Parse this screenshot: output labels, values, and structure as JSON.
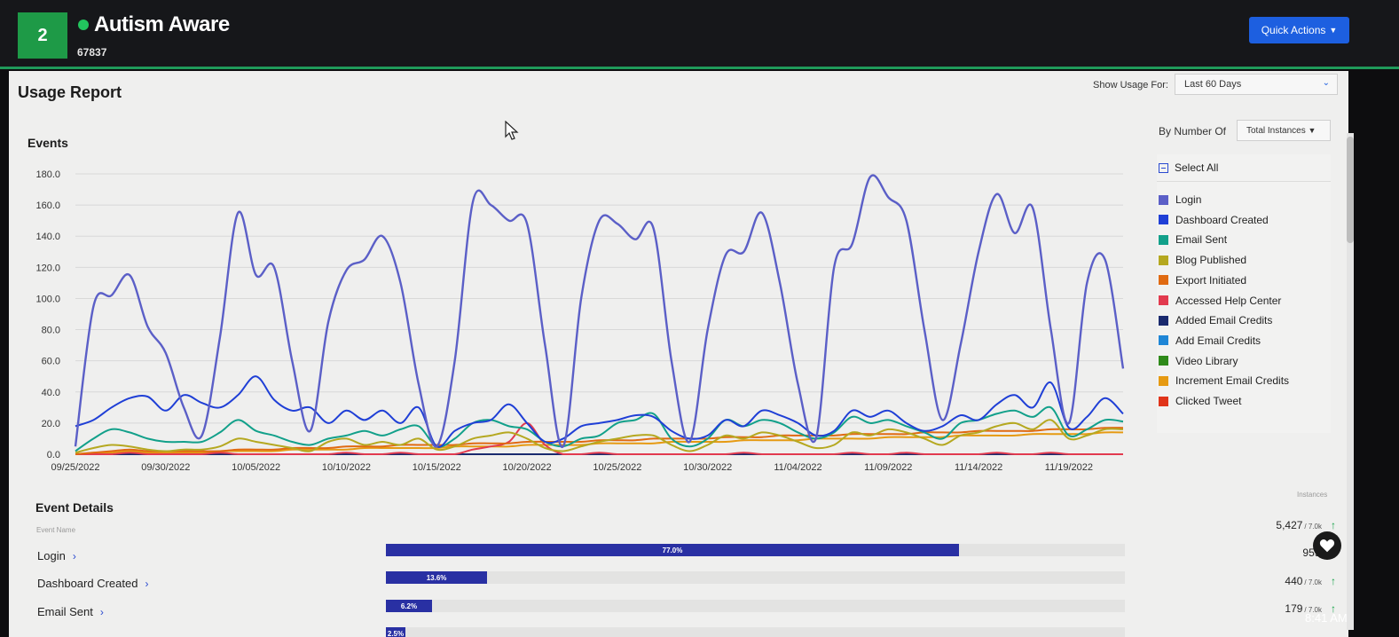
{
  "header": {
    "badge": "2",
    "org_name": "Autism Aware",
    "org_id": "67837",
    "quick_actions_label": "Quick Actions"
  },
  "report": {
    "title": "Usage Report",
    "show_usage_for_label": "Show Usage For:",
    "range_value": "Last 60 Days",
    "by_number_of_label": "By Number Of",
    "metric_value": "Total Instances",
    "events_heading": "Events",
    "select_all_label": "Select All"
  },
  "chart_data": {
    "type": "line",
    "title": "",
    "xlabel": "",
    "ylabel": "",
    "ylim": [
      0,
      180
    ],
    "yticks": [
      "0.0",
      "20.0",
      "40.0",
      "60.0",
      "80.0",
      "100.0",
      "120.0",
      "140.0",
      "160.0",
      "180.0"
    ],
    "x_ticks": [
      "09/25/2022",
      "09/30/2022",
      "10/05/2022",
      "10/10/2022",
      "10/15/2022",
      "10/20/2022",
      "10/25/2022",
      "10/30/2022",
      "11/04/2022",
      "11/09/2022",
      "11/14/2022",
      "11/19/2022"
    ],
    "x_dates": [
      "09/25",
      "09/26",
      "09/27",
      "09/28",
      "09/29",
      "09/30",
      "10/01",
      "10/02",
      "10/03",
      "10/04",
      "10/05",
      "10/06",
      "10/07",
      "10/08",
      "10/09",
      "10/10",
      "10/11",
      "10/12",
      "10/13",
      "10/14",
      "10/15",
      "10/16",
      "10/17",
      "10/18",
      "10/19",
      "10/20",
      "10/21",
      "10/22",
      "10/23",
      "10/24",
      "10/25",
      "10/26",
      "10/27",
      "10/28",
      "10/29",
      "10/30",
      "10/31",
      "11/01",
      "11/02",
      "11/03",
      "11/04",
      "11/05",
      "11/06",
      "11/07",
      "11/08",
      "11/09",
      "11/10",
      "11/11",
      "11/12",
      "11/13",
      "11/14",
      "11/15",
      "11/16",
      "11/17",
      "11/18",
      "11/19",
      "11/20",
      "11/21",
      "11/22"
    ],
    "grid": true,
    "legend_position": "right",
    "series": [
      {
        "name": "Login",
        "color": "#5b5fc7",
        "values": [
          5,
          95,
          102,
          115,
          82,
          65,
          30,
          12,
          75,
          155,
          115,
          120,
          60,
          15,
          85,
          118,
          125,
          140,
          110,
          45,
          5,
          60,
          162,
          160,
          150,
          148,
          70,
          5,
          100,
          150,
          148,
          138,
          145,
          60,
          8,
          80,
          128,
          130,
          155,
          110,
          45,
          10,
          120,
          135,
          178,
          165,
          150,
          80,
          22,
          70,
          130,
          167,
          142,
          158,
          80,
          20,
          110,
          125,
          55
        ]
      },
      {
        "name": "Dashboard Created",
        "color": "#1f3fd6",
        "values": [
          18,
          22,
          30,
          36,
          37,
          28,
          38,
          33,
          30,
          38,
          50,
          35,
          28,
          30,
          20,
          28,
          22,
          28,
          20,
          30,
          5,
          15,
          20,
          22,
          32,
          20,
          8,
          10,
          18,
          20,
          22,
          25,
          24,
          15,
          10,
          12,
          22,
          18,
          28,
          25,
          20,
          12,
          15,
          28,
          24,
          28,
          20,
          15,
          18,
          25,
          22,
          32,
          38,
          30,
          46,
          17,
          24,
          36,
          26
        ]
      },
      {
        "name": "Email Sent",
        "color": "#12a08a",
        "values": [
          2,
          10,
          16,
          14,
          10,
          8,
          8,
          8,
          14,
          22,
          15,
          12,
          8,
          6,
          10,
          12,
          15,
          12,
          16,
          18,
          5,
          10,
          20,
          22,
          18,
          16,
          8,
          5,
          10,
          12,
          20,
          22,
          26,
          10,
          5,
          10,
          22,
          18,
          22,
          20,
          14,
          10,
          14,
          24,
          20,
          22,
          18,
          14,
          10,
          20,
          22,
          26,
          28,
          24,
          30,
          12,
          16,
          22,
          21
        ]
      },
      {
        "name": "Blog Published",
        "color": "#b5a820",
        "values": [
          1,
          4,
          6,
          5,
          3,
          2,
          3,
          3,
          5,
          10,
          8,
          6,
          4,
          2,
          8,
          10,
          6,
          8,
          6,
          10,
          3,
          5,
          10,
          12,
          14,
          10,
          4,
          2,
          5,
          8,
          10,
          12,
          12,
          6,
          2,
          6,
          12,
          10,
          14,
          12,
          8,
          4,
          6,
          14,
          12,
          16,
          14,
          10,
          6,
          12,
          14,
          18,
          20,
          16,
          22,
          10,
          12,
          16,
          16
        ]
      },
      {
        "name": "Export Initiated",
        "color": "#e06a12",
        "values": [
          0,
          1,
          2,
          3,
          2,
          2,
          2,
          2,
          2,
          3,
          3,
          3,
          4,
          4,
          4,
          5,
          5,
          5,
          6,
          6,
          6,
          6,
          7,
          7,
          7,
          8,
          8,
          8,
          8,
          9,
          9,
          9,
          10,
          10,
          10,
          10,
          11,
          11,
          11,
          12,
          12,
          12,
          12,
          13,
          13,
          13,
          13,
          14,
          14,
          14,
          15,
          15,
          15,
          15,
          16,
          16,
          16,
          17,
          17
        ]
      },
      {
        "name": "Accessed Help Center",
        "color": "#e23a4e",
        "values": [
          0,
          0,
          0,
          1,
          0,
          0,
          0,
          0,
          1,
          0,
          0,
          0,
          0,
          0,
          0,
          1,
          0,
          0,
          1,
          0,
          0,
          0,
          3,
          5,
          8,
          20,
          6,
          0,
          0,
          1,
          0,
          0,
          0,
          0,
          0,
          0,
          0,
          1,
          0,
          0,
          0,
          0,
          0,
          1,
          0,
          0,
          1,
          0,
          0,
          0,
          0,
          1,
          0,
          0,
          1,
          0,
          0,
          0,
          0
        ]
      },
      {
        "name": "Added Email Credits",
        "color": "#1a2a6e",
        "values": [
          0,
          0,
          0,
          0,
          0,
          0,
          0,
          0,
          0,
          0,
          0,
          0,
          0,
          0,
          0,
          0,
          0,
          0,
          0,
          0,
          0,
          0,
          0,
          0,
          0,
          0,
          0,
          0,
          0,
          0,
          0,
          0,
          0,
          0,
          0,
          0,
          0,
          0,
          0,
          0,
          0,
          0,
          0,
          0,
          0,
          0,
          0,
          0,
          0,
          0,
          0,
          0,
          0,
          0,
          0,
          0,
          0,
          0,
          0
        ]
      },
      {
        "name": "Add Email Credits",
        "color": "#1f86d6",
        "values": [
          0,
          0,
          0,
          0,
          0,
          0,
          0,
          0,
          0,
          0,
          0,
          0,
          0,
          0,
          0,
          0,
          0,
          0,
          0,
          0,
          0,
          0,
          0,
          0,
          0,
          0,
          0,
          0,
          0,
          0,
          0,
          0,
          0,
          0,
          0,
          0,
          0,
          0,
          0,
          0,
          0,
          0,
          0,
          0,
          0,
          0,
          0,
          0,
          0,
          0,
          0,
          0,
          0,
          0,
          0,
          0,
          0,
          0,
          0
        ]
      },
      {
        "name": "Video Library",
        "color": "#2f8a1a",
        "values": [
          0,
          0,
          0,
          0,
          0,
          0,
          0,
          0,
          0,
          0,
          0,
          0,
          0,
          0,
          0,
          0,
          0,
          0,
          0,
          0,
          0,
          0,
          0,
          0,
          0,
          0,
          0,
          0,
          0,
          0,
          0,
          0,
          0,
          0,
          0,
          0,
          0,
          0,
          0,
          0,
          0,
          0,
          0,
          0,
          0,
          0,
          0,
          0,
          0,
          0,
          0,
          0,
          0,
          0,
          0,
          0,
          0,
          0,
          0
        ]
      },
      {
        "name": "Increment Email Credits",
        "color": "#e69a12",
        "values": [
          0,
          1,
          1,
          2,
          1,
          1,
          1,
          1,
          2,
          2,
          2,
          2,
          3,
          3,
          3,
          3,
          4,
          4,
          4,
          4,
          4,
          5,
          5,
          5,
          5,
          6,
          6,
          6,
          6,
          7,
          7,
          7,
          7,
          8,
          8,
          8,
          8,
          9,
          9,
          9,
          9,
          10,
          10,
          10,
          10,
          11,
          11,
          11,
          11,
          12,
          12,
          12,
          12,
          13,
          13,
          13,
          13,
          14,
          14
        ]
      },
      {
        "name": "Clicked Tweet",
        "color": "#e0341a",
        "values": [
          0,
          0,
          0,
          0,
          0,
          0,
          0,
          0,
          0,
          0,
          0,
          0,
          0,
          0,
          0,
          0,
          0,
          0,
          0,
          0,
          0,
          0,
          0,
          0,
          0,
          0,
          0,
          0,
          0,
          0,
          0,
          0,
          0,
          0,
          0,
          0,
          0,
          0,
          0,
          0,
          0,
          0,
          0,
          0,
          0,
          0,
          0,
          0,
          0,
          0,
          0,
          0,
          0,
          0,
          0,
          0,
          0,
          0,
          0
        ]
      }
    ]
  },
  "event_details": {
    "title": "Event Details",
    "column_event_name": "Event Name",
    "column_instances": "Instances",
    "rows": [
      {
        "name": "Login",
        "percent": 77.0,
        "percent_label": "77.0%",
        "count": "5,427",
        "total": "/ 7.0k",
        "trend": "↑"
      },
      {
        "name": "Dashboard Created",
        "percent": 13.6,
        "percent_label": "13.6%",
        "count": "959",
        "total": "/ 7.0",
        "trend": ""
      },
      {
        "name": "Email Sent",
        "percent": 6.2,
        "percent_label": "6.2%",
        "count": "440",
        "total": "/ 7.0k",
        "trend": "↑"
      },
      {
        "name": "",
        "percent": 2.5,
        "percent_label": "2.5%",
        "count": "179",
        "total": "/ 7.0k",
        "trend": "↑"
      }
    ]
  },
  "system": {
    "clock": "8:41 AM"
  },
  "icons": {
    "status": "status-dot-icon",
    "quick_actions_chevron": "chevron-down-icon",
    "heart": "heart-icon",
    "select_all": "minus-checkbox-icon",
    "cursor": "mouse-cursor-icon"
  }
}
